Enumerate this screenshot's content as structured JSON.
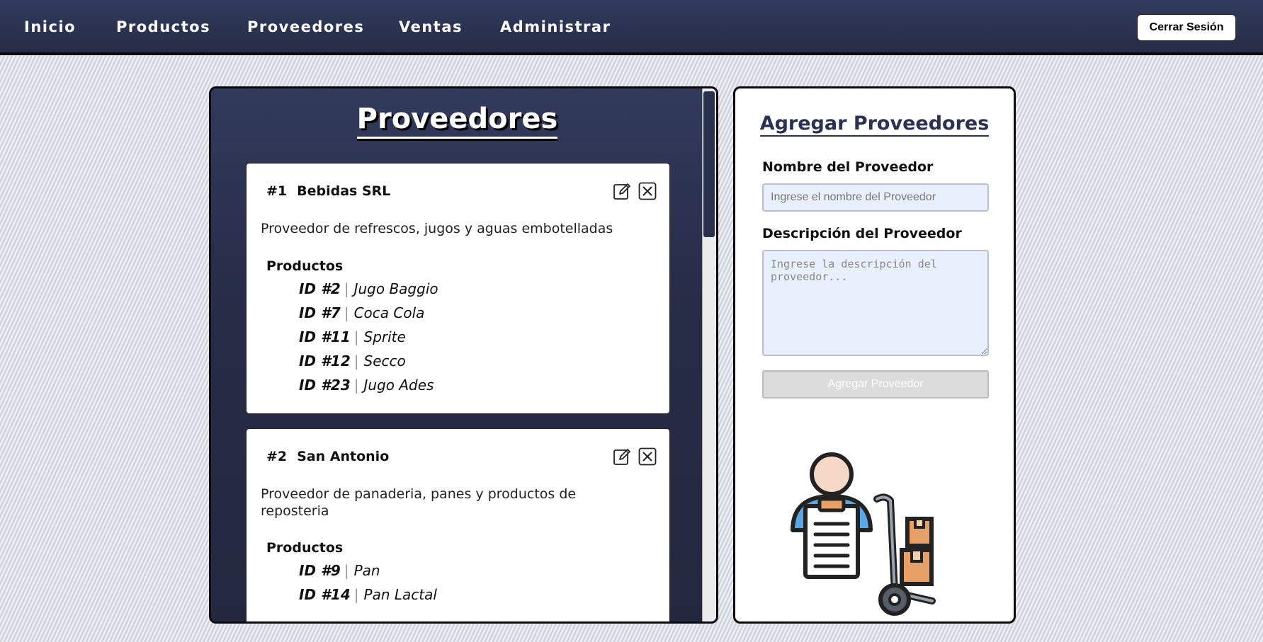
{
  "nav": {
    "items": [
      "Inicio",
      "Productos",
      "Proveedores",
      "Ventas",
      "Administrar"
    ],
    "logout_label": "Cerrar Sesión"
  },
  "list_panel": {
    "title": "Proveedores",
    "products_heading": "Productos",
    "suppliers": [
      {
        "number": "#1",
        "name": "Bebidas SRL",
        "description": "Proveedor de refrescos, jugos y aguas embotelladas",
        "products": [
          {
            "id": "ID #2",
            "name": "Jugo Baggio"
          },
          {
            "id": "ID #7",
            "name": "Coca Cola"
          },
          {
            "id": "ID #11",
            "name": "Sprite"
          },
          {
            "id": "ID #12",
            "name": "Secco"
          },
          {
            "id": "ID #23",
            "name": "Jugo Ades"
          }
        ]
      },
      {
        "number": "#2",
        "name": "San Antonio",
        "description": "Proveedor de panaderia, panes y productos de reposteria",
        "products": [
          {
            "id": "ID #9",
            "name": "Pan"
          },
          {
            "id": "ID #14",
            "name": "Pan Lactal"
          }
        ]
      }
    ],
    "icons": {
      "edit": "edit-icon",
      "delete": "close-icon"
    }
  },
  "form": {
    "title": "Agregar Proveedores",
    "name_label": "Nombre del Proveedor",
    "name_placeholder": "Ingrese el nombre del Proveedor",
    "description_label": "Descripción del Proveedor",
    "description_placeholder": "Ingrese la descripción del proveedor...",
    "submit_label": "Agregar Proveedor",
    "illustration": "supplier-illustration"
  },
  "colors": {
    "navbar": "#2a3150",
    "panel_dark": "#272c47",
    "accent_text": "#2a3152",
    "input_bg": "#e8effd"
  }
}
